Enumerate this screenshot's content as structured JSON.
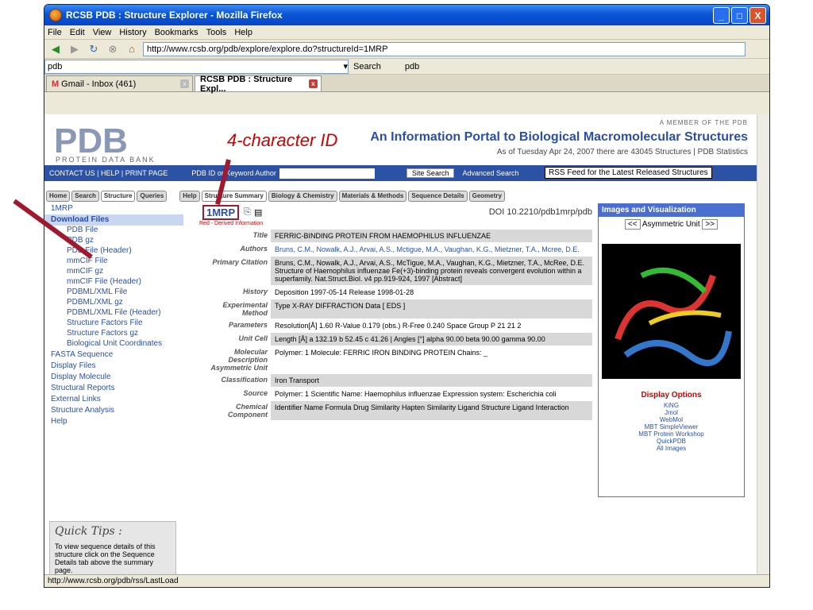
{
  "window": {
    "title": "RCSB PDB : Structure Explorer - Mozilla Firefox"
  },
  "menu": [
    "File",
    "Edit",
    "View",
    "History",
    "Bookmarks",
    "Tools",
    "Help"
  ],
  "address": "http://www.rcsb.org/pdb/explore/explore.do?structureId=1MRP",
  "search_bar": {
    "value": "pdb",
    "engine": "Search",
    "right_text": "pdb"
  },
  "tabs": [
    {
      "label": "Gmail - Inbox (461)"
    },
    {
      "label": "RCSB PDB : Structure Expl..."
    }
  ],
  "page": {
    "annotation": "4-character ID",
    "logo_sub": "PROTEIN DATA BANK",
    "member": "A MEMBER OF THE PDB",
    "portal_title": "An Information Portal to Biological Macromolecular Structures",
    "portal_sub": "As of Tuesday Apr 24, 2007 there are 43045 Structures | PDB Statistics",
    "contact": "CONTACT US | HELP | PRINT PAGE",
    "search_opts": "PDB ID or Keyword   Author",
    "site_search": "Site Search",
    "adv_search": "Advanced Search",
    "rss": "RSS Feed for the Latest Released Structures",
    "nav_tabs": [
      "Home",
      "Search",
      "Structure",
      "Queries",
      "Help",
      "Structure Summary",
      "Biology & Chemistry",
      "Materials & Methods",
      "Sequence Details",
      "Geometry"
    ],
    "sidebar": [
      {
        "label": "1MRP",
        "type": "top"
      },
      {
        "label": "Download Files",
        "type": "hl"
      },
      {
        "label": "PDB File"
      },
      {
        "label": "PDB gz"
      },
      {
        "label": "PDB File (Header)"
      },
      {
        "label": "mmCIF File"
      },
      {
        "label": "mmCIF gz"
      },
      {
        "label": "mmCIF File (Header)"
      },
      {
        "label": "PDBML/XML File"
      },
      {
        "label": "PDBML/XML gz"
      },
      {
        "label": "PDBML/XML File (Header)"
      },
      {
        "label": "Structure Factors File"
      },
      {
        "label": "Structure Factors gz"
      },
      {
        "label": "Biological Unit Coordinates"
      },
      {
        "label": "FASTA Sequence",
        "type": "top"
      },
      {
        "label": "Display Files",
        "type": "top"
      },
      {
        "label": "Display Molecule",
        "type": "top"
      },
      {
        "label": "Structural Reports",
        "type": "top"
      },
      {
        "label": "External Links",
        "type": "top"
      },
      {
        "label": "Structure Analysis",
        "type": "top"
      },
      {
        "label": "Help",
        "type": "top"
      }
    ],
    "quick_tips": {
      "title": "Quick Tips :",
      "text": "To view sequence details of this structure click on the Sequence Details tab above the summary page."
    },
    "id": "1MRP",
    "doi": "DOI 10.2210/pdb1mrp/pdb",
    "derived": "Red - Derived Information",
    "rows": [
      {
        "label": "Title",
        "value": "FERRIC-BINDING PROTEIN FROM HAEMOPHILUS INFLUENZAE",
        "gray": true
      },
      {
        "label": "Authors",
        "value": "Bruns, C.M., Nowalk, A.J., Arvai, A.S., Mctigue, M.A., Vaughan, K.G., Mietzner, T.A., Mcree, D.E.",
        "gray": false
      },
      {
        "label": "Primary Citation",
        "value": "Bruns, C.M., Nowalk, A.J., Arvai, A.S., McTigue, M.A., Vaughan, K.G., Mietzner, T.A., McRee, D.E. Structure of Haemophilus influenzae Fe(+3)-binding protein reveals convergent evolution within a superfamily. Nat.Struct.Biol. v4 pp.919-924, 1997 [Abstract]",
        "gray": true
      },
      {
        "label": "History",
        "value": "Deposition 1997-05-14   Release 1998-01-28",
        "gray": false
      },
      {
        "label": "Experimental Method",
        "value": "Type X-RAY DIFFRACTION   Data   [ EDS ]",
        "gray": true
      },
      {
        "label": "Parameters",
        "value": "Resolution[Å] 1.60    R-Value 0.179 (obs.)    R-Free 0.240    Space Group P 21 21 2",
        "gray": false
      },
      {
        "label": "Unit Cell",
        "value": "Length [Å] a 132.19  b 52.45  c 41.26 | Angles [°] alpha 90.00  beta 90.00  gamma 90.00",
        "gray": true
      },
      {
        "label": "Molecular Description Asymmetric Unit",
        "value": "Polymer: 1  Molecule: FERRIC IRON BINDING PROTEIN  Chains: _",
        "gray": false
      },
      {
        "label": "Classification",
        "value": "Iron Transport",
        "gray": true
      },
      {
        "label": "Source",
        "value": "Polymer: 1  Scientific Name: Haemophilus influenzae   Expression system: Escherichia coli",
        "gray": false
      },
      {
        "label": "Chemical Component",
        "value": "Identifier  Name  Formula  Drug Similarity  Hapten Similarity  Ligand Structure  Ligand Interaction",
        "gray": true
      }
    ],
    "images_title": "Images and Visualization",
    "asym_unit": "Asymmetric Unit",
    "display_options": "Display Options",
    "display_links": [
      "KiNG",
      "Jmol",
      "WebMol",
      "MBT SimpleViewer",
      "MBT Protein Workshop",
      "QuickPDB",
      "All Images"
    ]
  },
  "status": "http://www.rcsb.org/pdb/rss/LastLoad"
}
